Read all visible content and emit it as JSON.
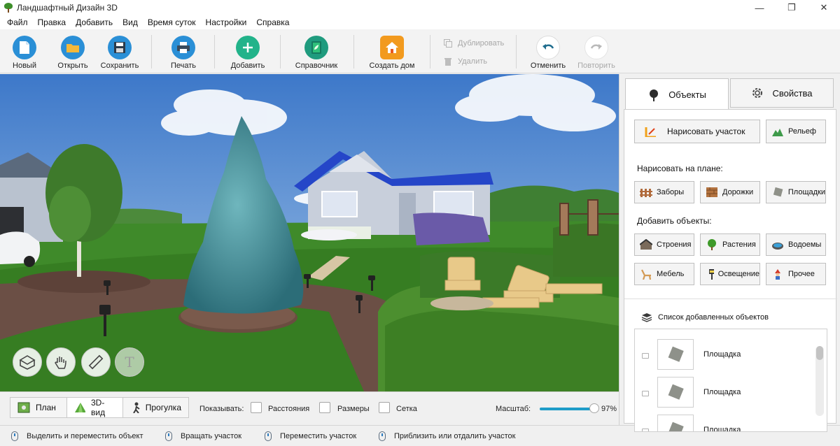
{
  "window": {
    "title": "Ландшафтный Дизайн 3D"
  },
  "menu": [
    "Файл",
    "Правка",
    "Добавить",
    "Вид",
    "Время суток",
    "Настройки",
    "Справка"
  ],
  "toolbar": {
    "new": "Новый",
    "open": "Открыть",
    "save": "Сохранить",
    "print": "Печать",
    "add": "Добавить",
    "reference": "Справочник",
    "create_house": "Создать дом",
    "duplicate": "Дублировать",
    "delete": "Удалить",
    "undo": "Отменить",
    "redo": "Повторить"
  },
  "view_tabs": {
    "plan": "План",
    "view3d": "3D-вид",
    "walk": "Прогулка",
    "active": "3D-вид"
  },
  "show": {
    "label": "Показывать:",
    "distances": "Расстояния",
    "sizes": "Размеры",
    "grid": "Сетка"
  },
  "scale": {
    "label": "Масштаб:",
    "value_text": "97%",
    "value": 0.97
  },
  "status_hints": [
    "Выделить и переместить объект",
    "Вращать участок",
    "Переместить участок",
    "Приблизить или отдалить участок"
  ],
  "panel": {
    "tabs": {
      "objects": "Объекты",
      "properties": "Свойства"
    },
    "draw_plot": "Нарисовать участок",
    "relief": "Рельеф",
    "draw_on_plan": "Нарисовать на плане:",
    "fences": "Заборы",
    "paths": "Дорожки",
    "areas": "Площадки",
    "add_objects": "Добавить объекты:",
    "buildings": "Строения",
    "plants": "Растения",
    "ponds": "Водоемы",
    "furniture": "Мебель",
    "lighting": "Освещение",
    "other": "Прочее",
    "list_title": "Список добавленных объектов",
    "list_items": [
      "Площадка",
      "Площадка",
      "Площадка"
    ]
  },
  "colors": {
    "sky": "#5b95d8",
    "grass": "#3f8a2a",
    "accent": "#1e9cc8",
    "roof": "#2546c8"
  },
  "icons": {
    "nav": [
      "rotate-icon",
      "hand-icon",
      "ruler-icon",
      "text-icon"
    ]
  }
}
